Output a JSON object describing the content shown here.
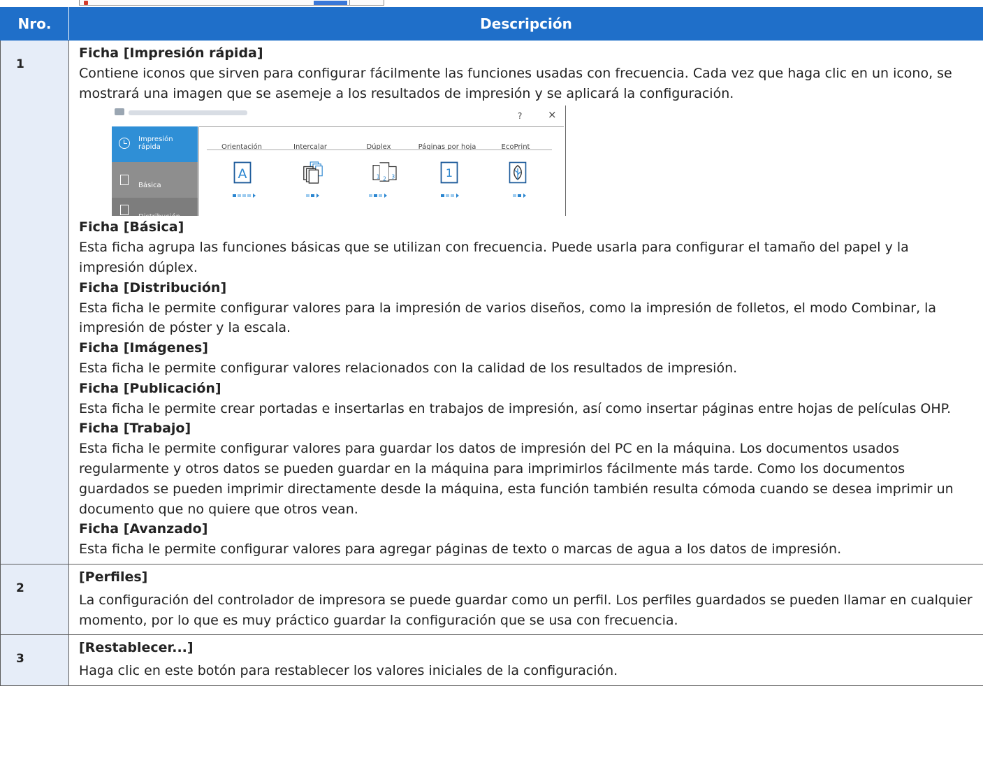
{
  "table": {
    "headers": {
      "number": "Nro.",
      "description": "Descripción"
    },
    "row1": {
      "number": "1",
      "quickprint_heading": "Ficha [Impresión rápida]",
      "quickprint_text": "Contiene iconos que sirven para configurar fácilmente las funciones usadas con frecuencia. Cada vez que haga clic en un icono, se mostrará una imagen que se asemeje a los resultados de impresión y se aplicará la configuración.",
      "basic_heading": "Ficha [Básica]",
      "basic_text": "Esta ficha agrupa las funciones básicas que se utilizan con frecuencia. Puede usarla para configurar el tamaño del papel y la impresión dúplex.",
      "layout_heading": "Ficha [Distribución]",
      "layout_text": "Esta ficha le permite configurar valores para la impresión de varios diseños, como la impresión de folletos, el modo Combinar, la impresión de póster y la escala.",
      "imaging_heading": "Ficha [Imágenes]",
      "imaging_text": "Esta ficha le permite configurar valores relacionados con la calidad de los resultados de impresión.",
      "publishing_heading": "Ficha [Publicación]",
      "publishing_text": "Esta ficha le permite crear portadas e insertarlas en trabajos de impresión, así como insertar páginas entre hojas de películas OHP.",
      "job_heading": "Ficha [Trabajo]",
      "job_text": "Esta ficha le permite configurar valores para guardar los datos de impresión del PC en la máquina. Los documentos usados regularmente y otros datos se pueden guardar en la máquina para imprimirlos fácilmente más tarde. Como los documentos guardados se pueden imprimir directamente desde la máquina, esta función también resulta cómoda cuando se desea imprimir un documento que no quiere que otros vean.",
      "advanced_heading": "Ficha [Avanzado]",
      "advanced_text": "Esta ficha le permite configurar valores para agregar páginas de texto o marcas de agua a los datos de impresión."
    },
    "row2": {
      "number": "2",
      "heading": "[Perfiles]",
      "text": "La configuración del controlador de impresora se puede guardar como un perfil. Los perfiles guardados se pueden llamar en cualquier momento, por lo que es muy práctico guardar la configuración que se usa con frecuencia."
    },
    "row3": {
      "number": "3",
      "heading": "[Restablecer...]",
      "text": "Haga clic en este botón para restablecer los valores iniciales de la configuración."
    }
  },
  "dialog": {
    "help": "?",
    "close": "×",
    "tabs": [
      {
        "label": "Impresión rápida",
        "icon": "clock-icon"
      },
      {
        "label": "Básica",
        "icon": "list-icon"
      },
      {
        "label": "Distribución",
        "icon": "layout-icon"
      }
    ],
    "columns": [
      "Orientación",
      "Intercalar",
      "Dúplex",
      "Páginas por hoja",
      "EcoPrint"
    ],
    "icon_glyphs": {
      "orientation": "A",
      "pages_per_sheet": "1"
    },
    "colors": {
      "accent": "#2f8fd6",
      "header": "#1f6fc9",
      "sidebar": "#8e8e8e",
      "number_cell": "#e6edf8"
    }
  }
}
